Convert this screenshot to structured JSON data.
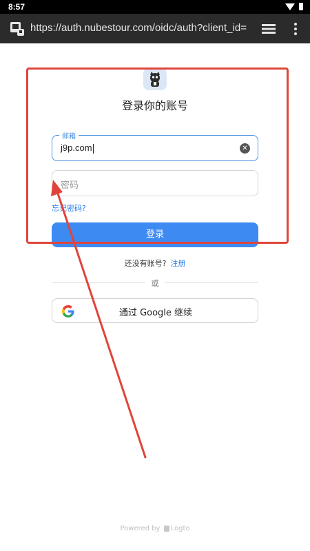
{
  "status_bar": {
    "time": "8:57",
    "icons": [
      "wifi-icon",
      "battery-icon"
    ]
  },
  "browser": {
    "url": "https://auth.nubestour.com/oidc/auth?client_id=",
    "icons": [
      "site-settings-icon",
      "tabs-icon",
      "more-menu-icon"
    ]
  },
  "login": {
    "title": "登录你的账号",
    "email_legend": "邮箱",
    "email_value": "j9p.com",
    "password_placeholder": "密码",
    "forgot_password": "忘记密码?",
    "login_button": "登录",
    "no_account_text": "还没有账号?",
    "signup_link": "注册",
    "divider_text": "或",
    "google_button": "通过 Google 继续"
  },
  "footer": {
    "powered_by": "Powered by",
    "brand": "Logto"
  },
  "colors": {
    "accent": "#3d8bf2",
    "link": "#2f80ed",
    "annotation": "#e0443a",
    "toolbar": "#2b2b2b"
  }
}
